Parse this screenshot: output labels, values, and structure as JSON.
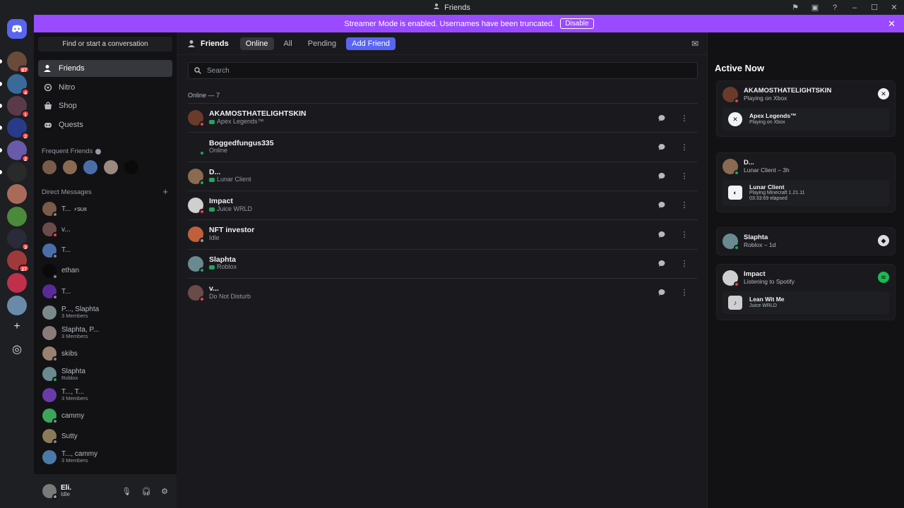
{
  "window": {
    "title": "Friends"
  },
  "banner": {
    "text": "Streamer Mode is enabled. Usernames have been truncated.",
    "disable_label": "Disable",
    "color": "#9b4bff"
  },
  "guilds": {
    "badges": [
      "87",
      "4",
      "1",
      "2",
      "2",
      "3",
      "27"
    ]
  },
  "sidebar": {
    "find_label": "Find or start a conversation",
    "nav": [
      {
        "label": "Friends",
        "icon": "friends-icon"
      },
      {
        "label": "Nitro",
        "icon": "nitro-icon"
      },
      {
        "label": "Shop",
        "icon": "shop-icon"
      },
      {
        "label": "Quests",
        "icon": "quests-icon"
      }
    ],
    "frequent_label": "Frequent Friends",
    "dm_label": "Direct Messages",
    "dms": [
      {
        "name": "T...",
        "tag": "⚡SUII",
        "sub": "",
        "status": "offline",
        "color": "#7a5a48"
      },
      {
        "name": "v...",
        "tag": "",
        "sub": "",
        "status": "dnd",
        "color": "#6b4a4a"
      },
      {
        "name": "T...",
        "tag": "",
        "sub": "",
        "status": "offline",
        "color": "#4a6ea8"
      },
      {
        "name": "ethan",
        "tag": "",
        "sub": "",
        "status": "offline",
        "color": "#0a0a0a"
      },
      {
        "name": "T...",
        "tag": "",
        "sub": "",
        "status": "offline",
        "color": "#5a2a9a"
      },
      {
        "name": "P..., Slaphta",
        "tag": "",
        "sub": "3 Members",
        "status": "group",
        "color": "#7a8a8a"
      },
      {
        "name": "Slaphta, P...",
        "tag": "",
        "sub": "3 Members",
        "status": "group",
        "color": "#8a7a7a"
      },
      {
        "name": "skibs",
        "tag": "",
        "sub": "",
        "status": "offline",
        "color": "#9a8070"
      },
      {
        "name": "Slaphta",
        "tag": "",
        "sub": "Roblox",
        "status": "online",
        "color": "#6a8a90"
      },
      {
        "name": "T..., T...",
        "tag": "",
        "sub": "3 Members",
        "status": "group",
        "color": "#6a3aaa"
      },
      {
        "name": "cammy",
        "tag": "",
        "sub": "",
        "status": "offline",
        "color": "#3ba55c"
      },
      {
        "name": "Sutty",
        "tag": "",
        "sub": "",
        "status": "offline",
        "color": "#8a7a5a"
      },
      {
        "name": "T..., cammy",
        "tag": "",
        "sub": "3 Members",
        "status": "group",
        "color": "#4a7aa8"
      }
    ],
    "user": {
      "name": "Eli.",
      "status": "Idle"
    }
  },
  "main": {
    "title": "Friends",
    "tabs": [
      "Online",
      "All",
      "Pending"
    ],
    "add_friend_label": "Add Friend",
    "search_placeholder": "Search",
    "online_count": "Online — 7",
    "friends": [
      {
        "name": "AKAMOSTHATELIGHTSKIN",
        "sub": "Apex Legends™",
        "status": "dnd",
        "activity": true,
        "color": "#6a3a2a"
      },
      {
        "name": "Boggedfungus335",
        "sub": "Online",
        "status": "online",
        "activity": false,
        "color": "#1a1a1a"
      },
      {
        "name": "D...",
        "sub": "Lunar Client",
        "status": "online",
        "activity": true,
        "color": "#8a6a50"
      },
      {
        "name": "Impact",
        "sub": "Juice WRLD",
        "status": "dnd",
        "activity": true,
        "color": "#cfcfcf"
      },
      {
        "name": "NFT investor",
        "sub": "Idle",
        "status": "idle",
        "activity": false,
        "color": "#c0603a"
      },
      {
        "name": "Slaphta",
        "sub": "Roblox",
        "status": "online",
        "activity": true,
        "color": "#6a8a90"
      },
      {
        "name": "v...",
        "sub": "Do Not Disturb",
        "status": "dnd",
        "activity": false,
        "color": "#6b4a4a"
      }
    ]
  },
  "active_now": {
    "title": "Active Now",
    "cards": [
      {
        "name": "AKAMOSTHATELIGHTSKIN",
        "sub": "Playing on Xbox",
        "status": "dnd",
        "color": "#6a3a2a",
        "right_icon": "xbox-icon",
        "inner": {
          "title": "Apex Legends™",
          "lines": [
            "Playing on Xbox"
          ],
          "icon": "xbox-icon"
        }
      },
      {
        "name": "D...",
        "sub": "Lunar Client – 3h",
        "status": "online",
        "color": "#8a6a50",
        "right_icon": "",
        "inner": {
          "title": "Lunar Client",
          "lines": [
            "Playing Minecraft 1.21.11",
            "03:33:69 elapsed"
          ],
          "icon": "lunar-icon"
        }
      },
      {
        "name": "Slaphta",
        "sub": "Roblox – 1d",
        "status": "online",
        "color": "#6a8a90",
        "right_icon": "roblox-icon",
        "inner": null
      },
      {
        "name": "Impact",
        "sub": "Listening to Spotify",
        "status": "dnd",
        "color": "#cfcfcf",
        "right_icon": "spotify-icon",
        "inner": {
          "title": "Lean Wit Me",
          "lines": [
            "Juice WRLD"
          ],
          "icon": "album-art-icon"
        }
      }
    ]
  }
}
